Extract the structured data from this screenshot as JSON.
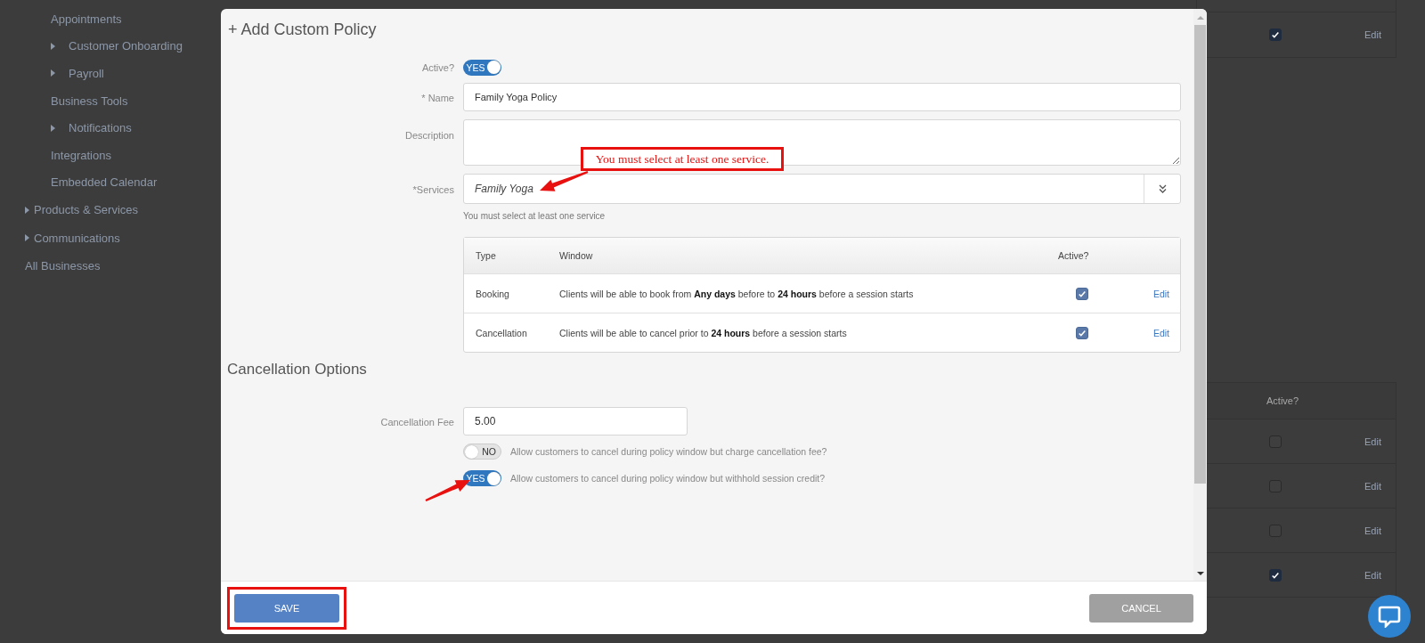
{
  "sidebar": {
    "sub_items": [
      {
        "label": "Appointments",
        "expandable": false
      },
      {
        "label": "Customer Onboarding",
        "expandable": true
      },
      {
        "label": "Payroll",
        "expandable": true
      },
      {
        "label": "Business Tools",
        "expandable": false
      },
      {
        "label": "Notifications",
        "expandable": true
      },
      {
        "label": "Integrations",
        "expandable": false
      },
      {
        "label": "Embedded Calendar",
        "expandable": false
      }
    ],
    "items": [
      {
        "label": "Products & Services",
        "expandable": true
      },
      {
        "label": "Communications",
        "expandable": true
      },
      {
        "label": "All Businesses",
        "expandable": false
      }
    ]
  },
  "background": {
    "top_table": {
      "rows": [
        {
          "checked": true,
          "action": "Edit"
        }
      ]
    },
    "bottom_table": {
      "active_heading": "Active?",
      "rows": [
        {
          "checked": false,
          "action": "Edit"
        },
        {
          "checked": false,
          "action": "Edit"
        },
        {
          "checked": false,
          "action": "Edit"
        },
        {
          "checked": true,
          "action": "Edit"
        }
      ]
    }
  },
  "modal": {
    "title": "+ Add Custom Policy",
    "active": {
      "label": "Active?",
      "on": true,
      "text": "YES"
    },
    "name": {
      "label": "* Name",
      "value": "Family Yoga Policy"
    },
    "description": {
      "label": "Description"
    },
    "services": {
      "label": "*Services",
      "value": "Family Yoga",
      "help": "You must select at least one service"
    },
    "policy_table": {
      "columns": [
        "Type",
        "Window",
        "Active?"
      ],
      "rows": [
        {
          "type": "Booking",
          "window": "Clients will be able to book from **Any days** before to **24 hours** before a session starts",
          "active": true,
          "action": "Edit"
        },
        {
          "type": "Cancellation",
          "window": "Clients will be able to cancel prior to **24 hours** before a session starts",
          "active": true,
          "action": "Edit"
        }
      ]
    },
    "section_title": "Cancellation Options",
    "fee": {
      "label": "Cancellation Fee",
      "value": "5.00"
    },
    "options": [
      {
        "on": false,
        "text": "NO",
        "label": "Allow customers to cancel during policy window but charge cancellation fee?"
      },
      {
        "on": true,
        "text": "YES",
        "label": "Allow customers to cancel during policy window but withhold session credit?"
      }
    ],
    "buttons": {
      "save": "SAVE",
      "cancel": "CANCEL"
    }
  },
  "annotations": [
    {
      "kind": "callout",
      "text": "You must select at least one service."
    },
    {
      "kind": "arrow"
    },
    {
      "kind": "frame"
    }
  ]
}
